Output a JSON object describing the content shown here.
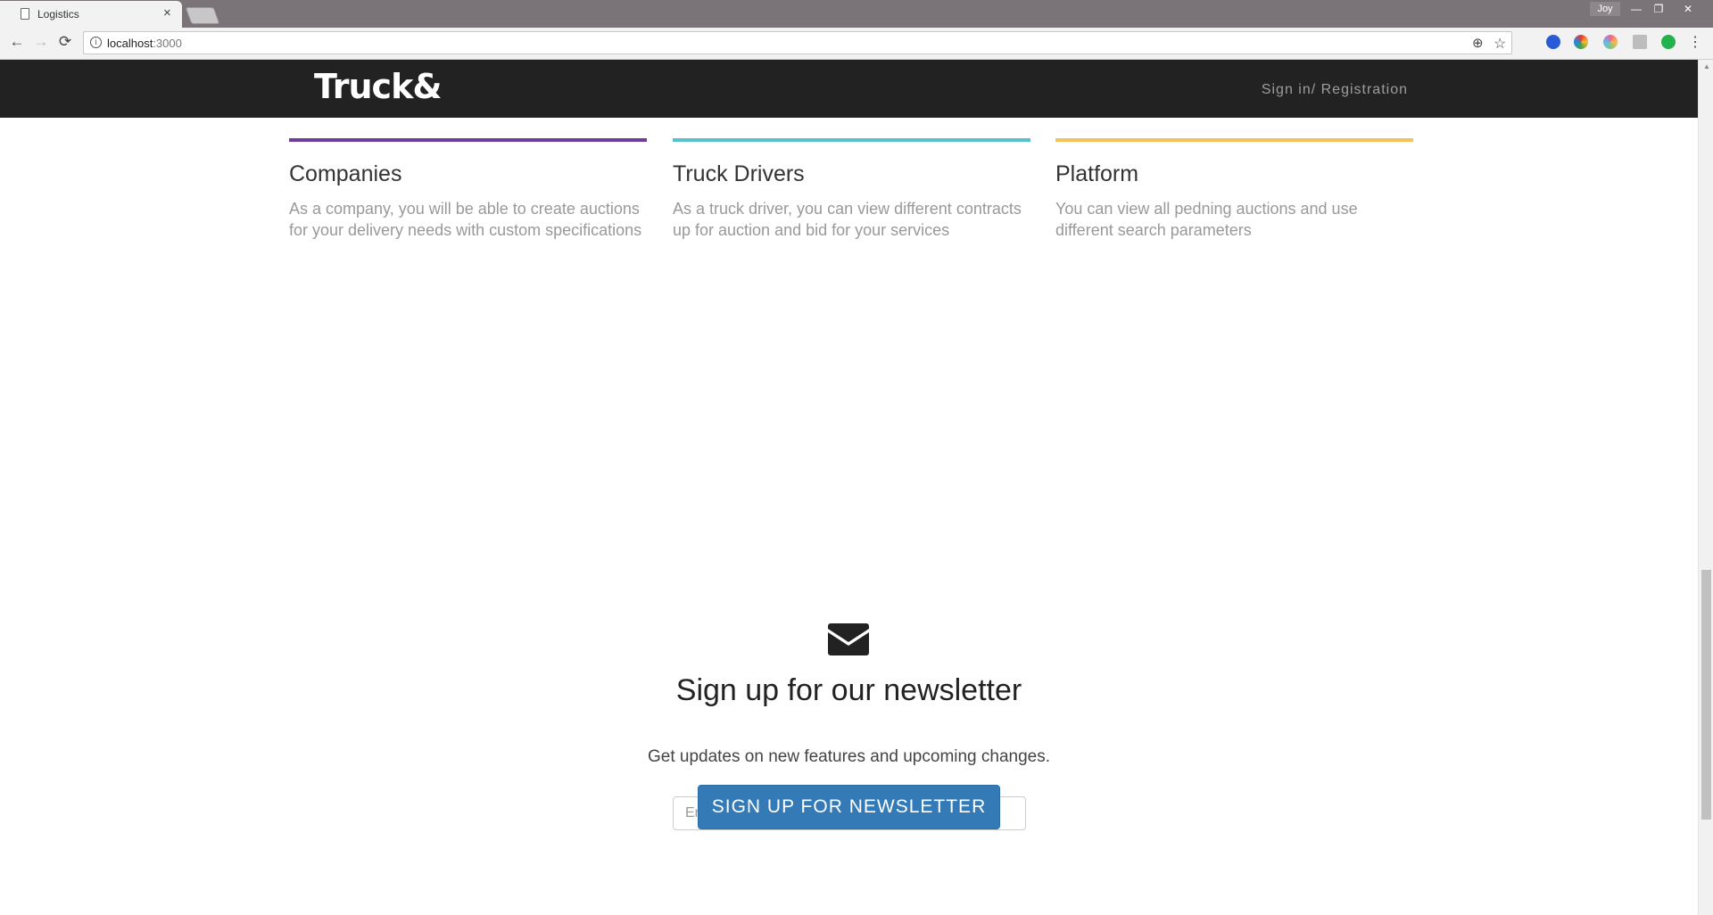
{
  "browser": {
    "tab_title": "Logistics",
    "tab_close": "×",
    "profile_name": "Joy",
    "url_host": "localhost",
    "url_port": ":3000",
    "nav_back": "←",
    "nav_forward": "→",
    "nav_reload": "⟳",
    "zoom_icon": "⊕",
    "star_icon": "☆",
    "menu_icon": "⋮",
    "window_minimize": "—",
    "window_restore": "❐",
    "window_close": "✕"
  },
  "site": {
    "logo": "Truck&",
    "signin_link": "Sign in/ Registration"
  },
  "features": [
    {
      "title": "Companies",
      "text": "As a company, you will be able to create auctions for your delivery needs with custom specifications",
      "color": "#6f3d9c"
    },
    {
      "title": "Truck Drivers",
      "text": "As a truck driver, you can view different contracts up for auction and bid for your services",
      "color": "#5bc0ce"
    },
    {
      "title": "Platform",
      "text": "You can view all pedning auctions and use different search parameters",
      "color": "#f6c15a"
    }
  ],
  "newsletter": {
    "icon": "envelope-icon",
    "title": "Sign up for our newsletter",
    "subtitle": "Get updates on new features and upcoming changes.",
    "email_placeholder": "Enter Email",
    "email_value": "",
    "button_label": "SIGN UP FOR NEWSLETTER"
  },
  "colors": {
    "navbar": "#222222",
    "primary_button": "#337ab7"
  }
}
